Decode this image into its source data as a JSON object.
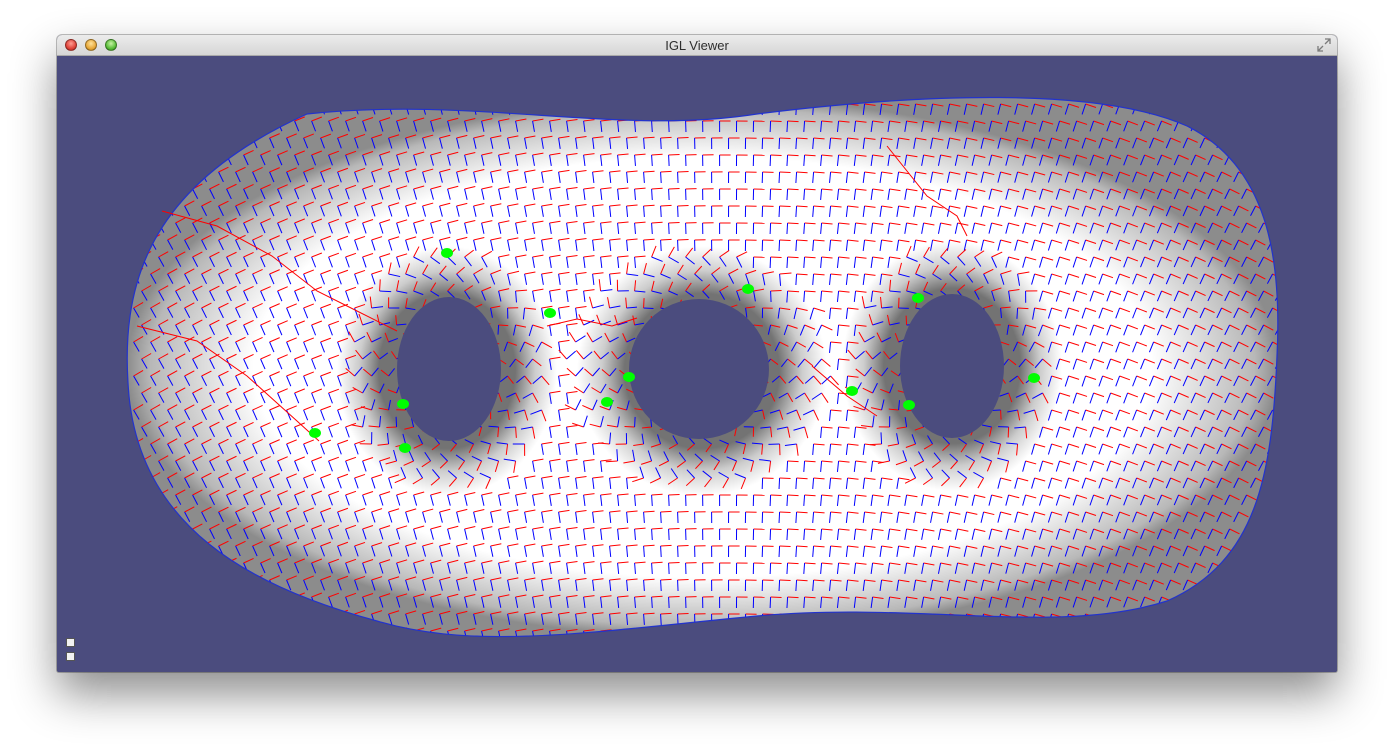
{
  "window": {
    "title": "IGL Viewer"
  },
  "titlebar": {
    "close_icon": "close-icon",
    "minimize_icon": "minimize-icon",
    "zoom_icon": "zoom-icon",
    "fullscreen_icon": "fullscreen-toggle-icon"
  },
  "viewport": {
    "background_color": "#4b4c7e",
    "mesh_color": "#ffffff",
    "field_colors": [
      "#ff0000",
      "#0000ff"
    ],
    "singularity_color": "#00ff00"
  },
  "toolbar": {
    "tools": [
      "view-tool-icon",
      "settings-tool-icon"
    ]
  }
}
